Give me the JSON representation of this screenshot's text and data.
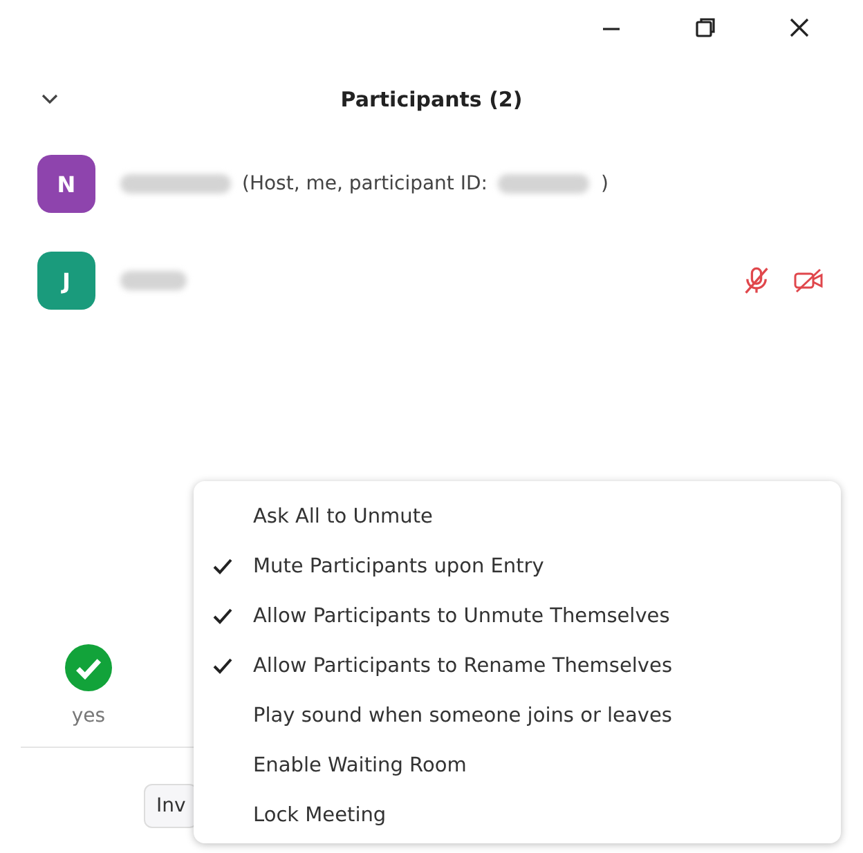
{
  "window": {
    "title": "Participants (2)"
  },
  "participants": [
    {
      "initial": "N",
      "color": "#8e44ad",
      "name_redacted": true,
      "role_text": "(Host, me, participant ID:",
      "id_redacted": true,
      "closing": ")",
      "audio_muted": false,
      "video_off": false
    },
    {
      "initial": "J",
      "color": "#1a9b7c",
      "name_redacted": true,
      "audio_muted": true,
      "video_off": true
    }
  ],
  "reaction": {
    "label": "yes"
  },
  "invite_button": {
    "label": "Inv"
  },
  "menu": {
    "items": [
      {
        "label": "Ask All to Unmute",
        "checked": false
      },
      {
        "label": "Mute Participants upon Entry",
        "checked": true
      },
      {
        "label": "Allow Participants to Unmute Themselves",
        "checked": true
      },
      {
        "label": "Allow Participants to Rename Themselves",
        "checked": true
      },
      {
        "label": "Play sound when someone joins or leaves",
        "checked": false
      },
      {
        "label": "Enable Waiting Room",
        "checked": false
      },
      {
        "label": "Lock Meeting",
        "checked": false
      }
    ]
  }
}
